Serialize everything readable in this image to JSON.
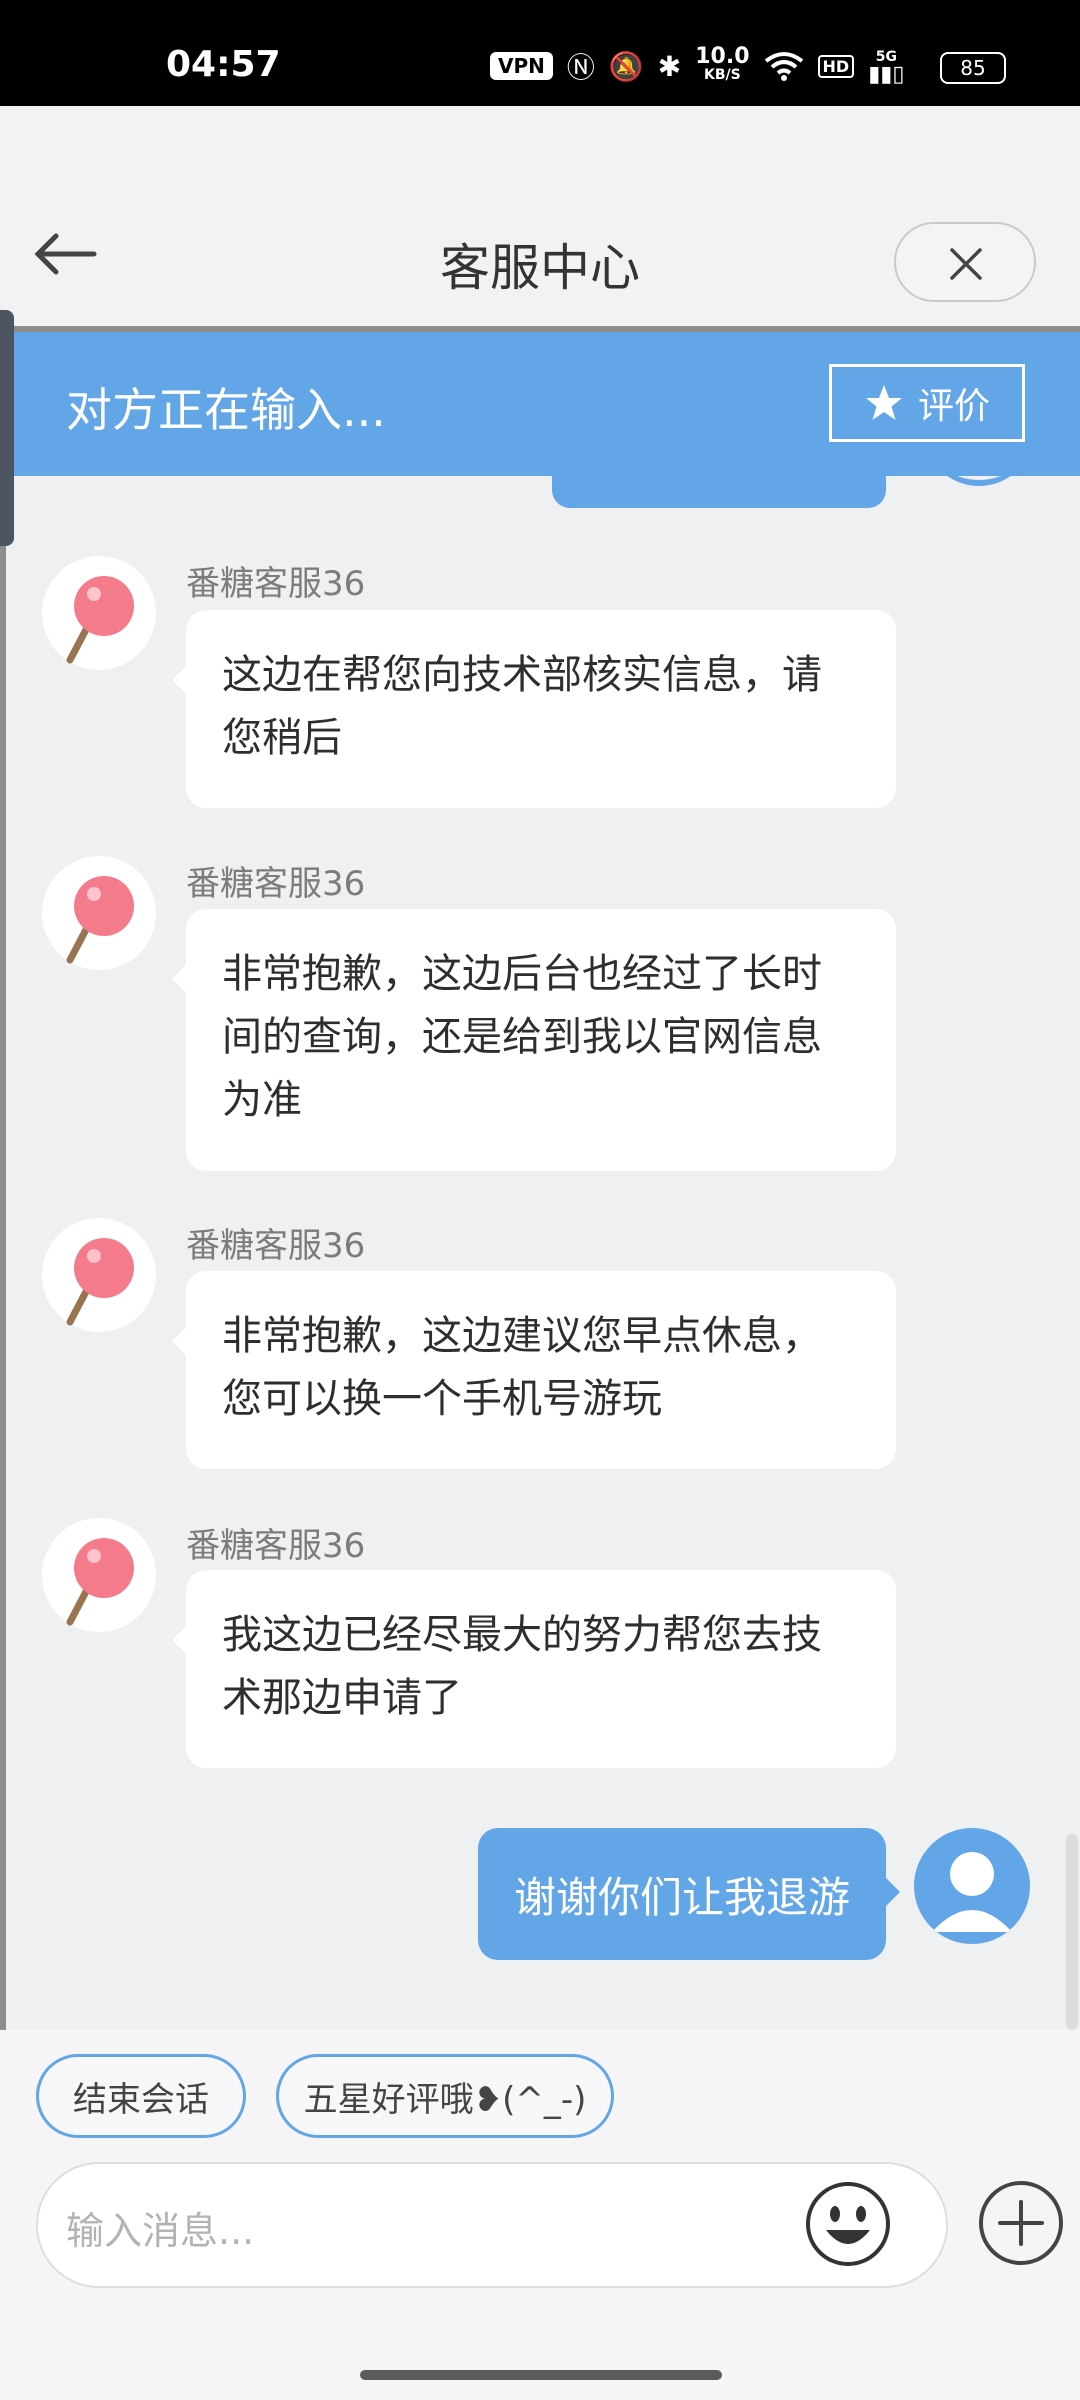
{
  "status_bar": {
    "time": "04:57",
    "vpn": "VPN",
    "speed_value": "10.0",
    "speed_unit": "KB/S",
    "hd": "HD",
    "network": "5G",
    "battery": "85"
  },
  "header": {
    "title": "客服中心",
    "back_icon": "arrow-left-icon",
    "close_icon": "close-icon"
  },
  "typing_bar": {
    "text": "对方正在输入...",
    "rate_label": "评价",
    "rate_icon": "star-icon"
  },
  "messages": [
    {
      "sender": "番糖客服36",
      "text": "这边在帮您向技术部核实信息，请您稍后"
    },
    {
      "sender": "番糖客服36",
      "text": "非常抱歉，这边后台也经过了长时间的查询，还是给到我以官网信息为准"
    },
    {
      "sender": "番糖客服36",
      "text": "非常抱歉，这边建议您早点休息，您可以换一个手机号游玩"
    },
    {
      "sender": "番糖客服36",
      "text": "我这边已经尽最大的努力帮您去技术那边申请了"
    }
  ],
  "user_message": {
    "text": "谢谢你们让我退游"
  },
  "quick_replies": [
    "结束会话",
    "五星好评哦❥(^_-)"
  ],
  "composer": {
    "placeholder": "输入消息...",
    "emoji_icon": "smiley-icon",
    "plus_icon": "plus-icon"
  },
  "colors": {
    "accent": "#62a6e8",
    "status_bar": "#000000",
    "background": "#eff0f2"
  }
}
